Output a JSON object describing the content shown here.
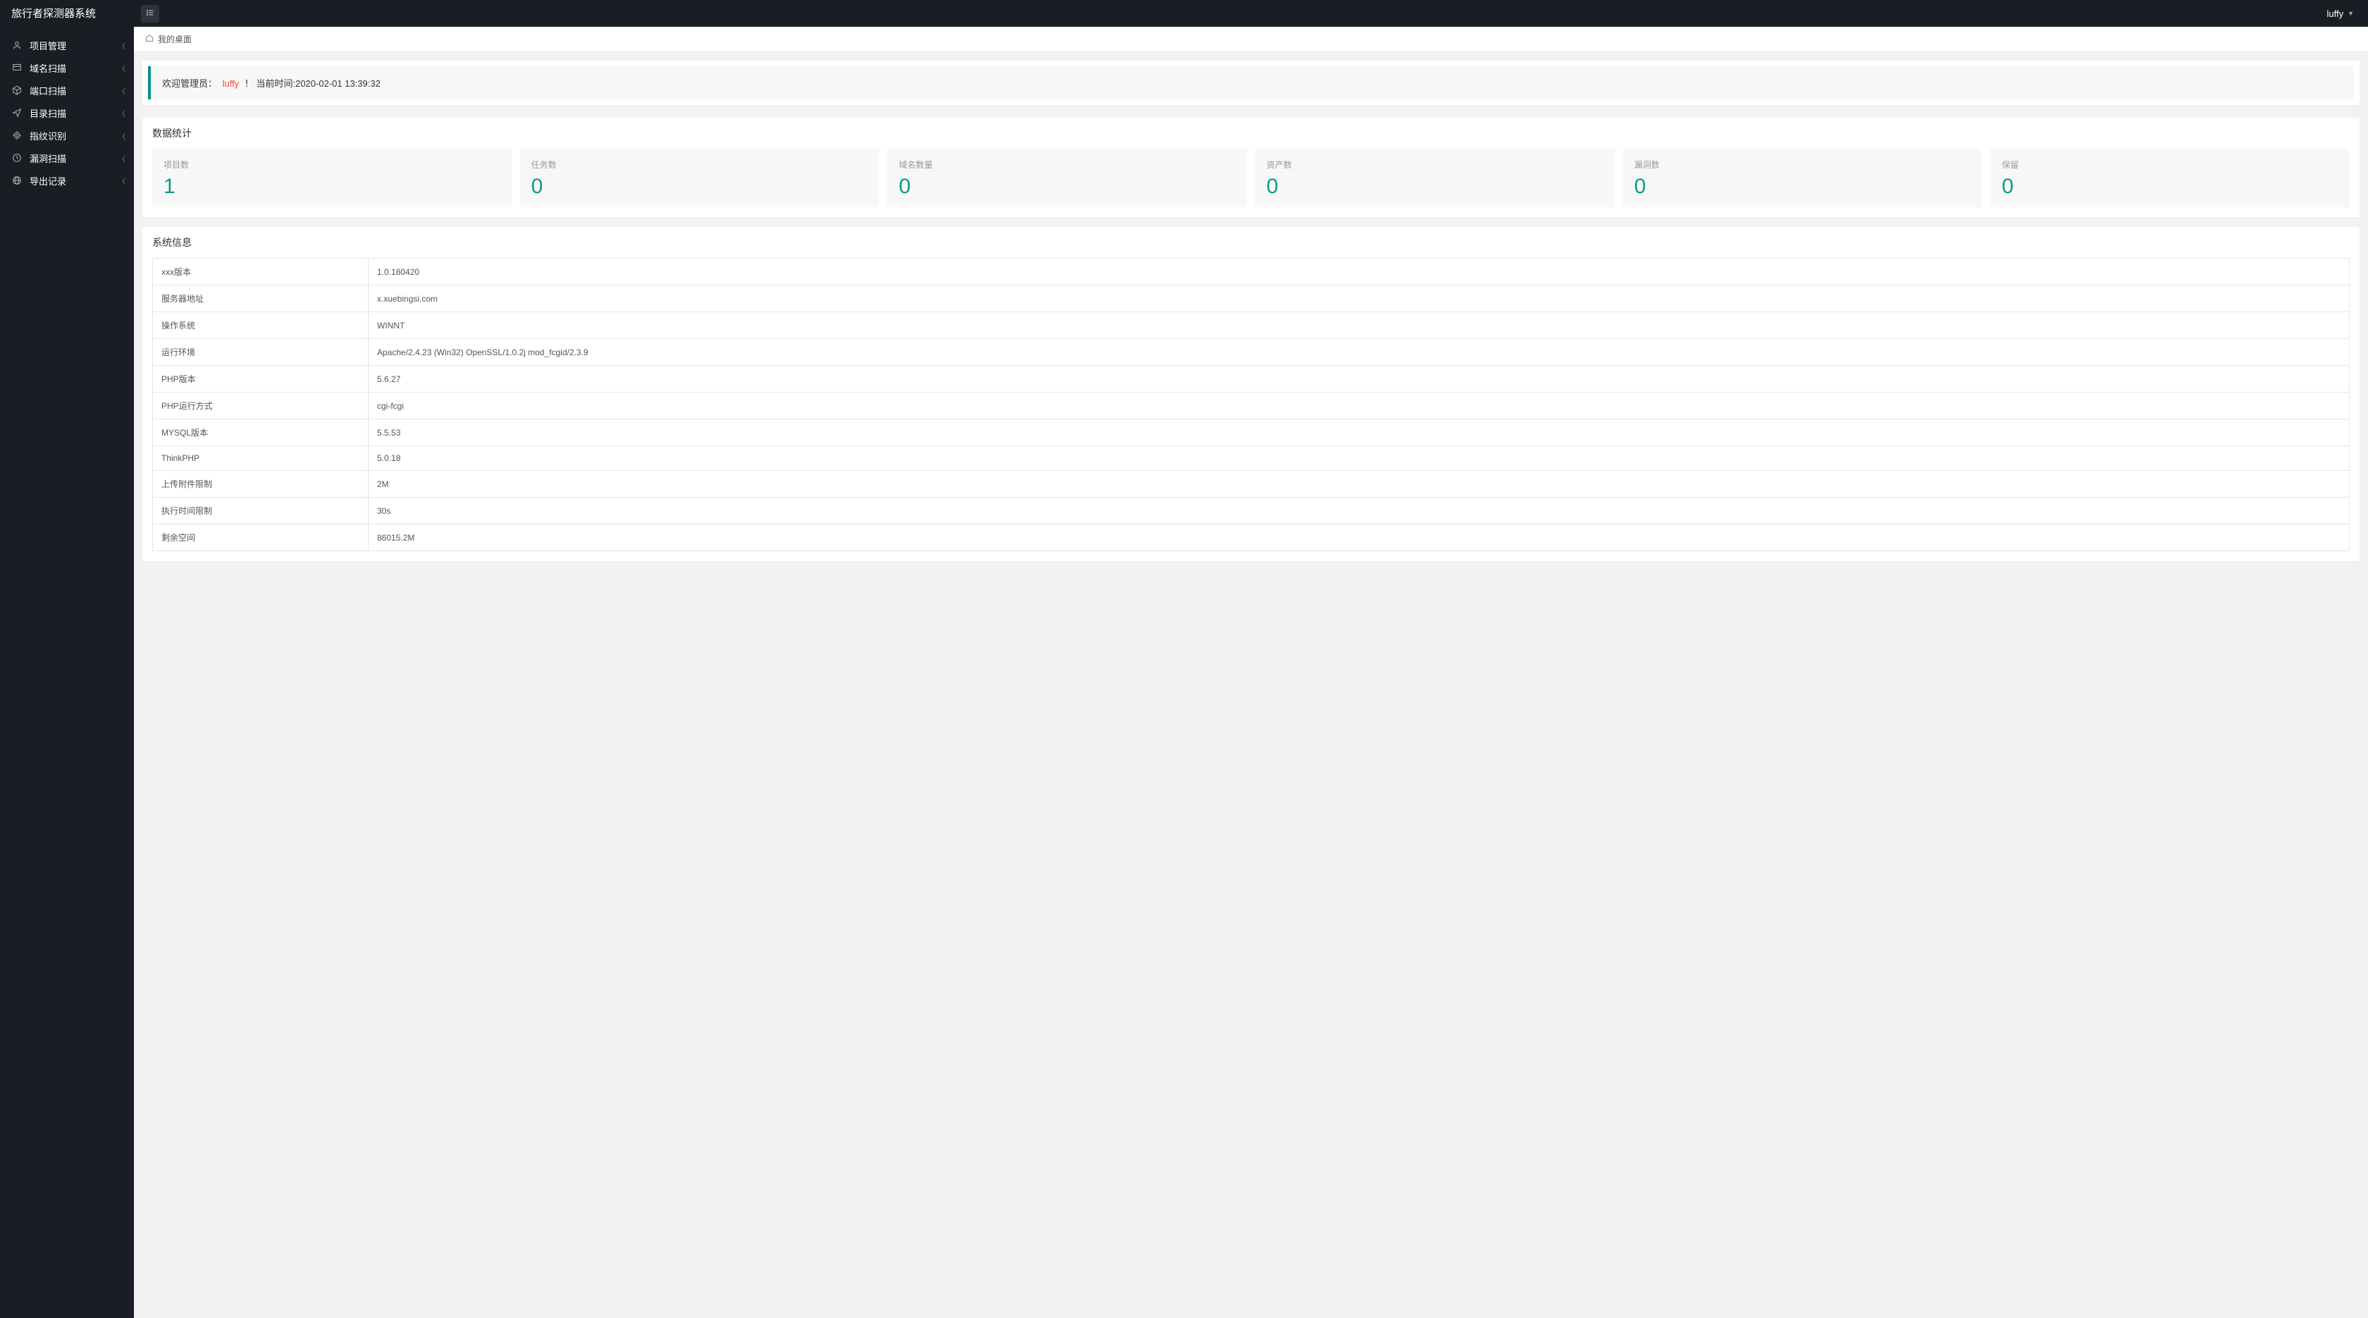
{
  "brand": "旅行者探测器系统",
  "user": {
    "name": "luffy"
  },
  "sidebar": {
    "items": [
      {
        "label": "项目管理",
        "icon": "user-icon"
      },
      {
        "label": "域名扫描",
        "icon": "domain-icon"
      },
      {
        "label": "端口扫描",
        "icon": "box-icon"
      },
      {
        "label": "目录扫描",
        "icon": "send-icon"
      },
      {
        "label": "指纹识别",
        "icon": "fingerprint-icon"
      },
      {
        "label": "漏洞扫描",
        "icon": "clock-icon"
      },
      {
        "label": "导出记录",
        "icon": "globe-icon"
      }
    ]
  },
  "breadcrumb": {
    "title": "我的桌面"
  },
  "welcome": {
    "prefix": "欢迎管理员：",
    "username": "luffy",
    "suffix": "！ 当前时间:2020-02-01 13:39:32"
  },
  "stats": {
    "title": "数据统计",
    "cards": [
      {
        "label": "项目数",
        "value": "1"
      },
      {
        "label": "任务数",
        "value": "0"
      },
      {
        "label": "域名数量",
        "value": "0"
      },
      {
        "label": "资产数",
        "value": "0"
      },
      {
        "label": "漏洞数",
        "value": "0"
      },
      {
        "label": "保留",
        "value": "0"
      }
    ]
  },
  "sysinfo": {
    "title": "系统信息",
    "rows": [
      {
        "key": "xxx版本",
        "value": "1.0.180420"
      },
      {
        "key": "服务器地址",
        "value": "x.xuebingsi.com"
      },
      {
        "key": "操作系统",
        "value": "WINNT"
      },
      {
        "key": "运行环境",
        "value": "Apache/2.4.23 (Win32) OpenSSL/1.0.2j mod_fcgid/2.3.9"
      },
      {
        "key": "PHP版本",
        "value": "5.6.27"
      },
      {
        "key": "PHP运行方式",
        "value": "cgi-fcgi"
      },
      {
        "key": "MYSQL版本",
        "value": "5.5.53"
      },
      {
        "key": "ThinkPHP",
        "value": "5.0.18"
      },
      {
        "key": "上传附件限制",
        "value": "2M"
      },
      {
        "key": "执行时间限制",
        "value": "30s"
      },
      {
        "key": "剩余空间",
        "value": "86015.2M"
      }
    ]
  }
}
